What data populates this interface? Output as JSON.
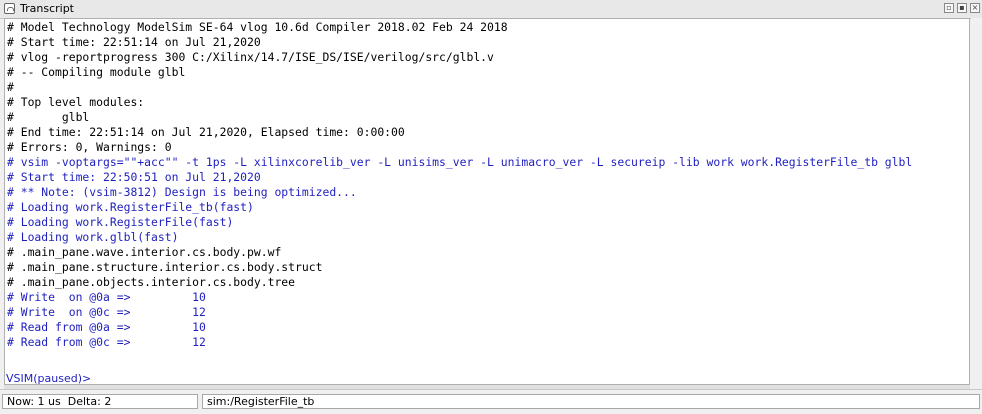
{
  "window": {
    "title": "Transcript"
  },
  "transcript": {
    "lines": [
      {
        "text": "# Model Technology ModelSim SE-64 vlog 10.6d Compiler 2018.02 Feb 24 2018",
        "blue": false
      },
      {
        "text": "# Start time: 22:51:14 on Jul 21,2020",
        "blue": false
      },
      {
        "text": "# vlog -reportprogress 300 C:/Xilinx/14.7/ISE_DS/ISE/verilog/src/glbl.v",
        "blue": false
      },
      {
        "text": "# -- Compiling module glbl",
        "blue": false
      },
      {
        "text": "#",
        "blue": false
      },
      {
        "text": "# Top level modules:",
        "blue": false
      },
      {
        "text": "#       glbl",
        "blue": false
      },
      {
        "text": "# End time: 22:51:14 on Jul 21,2020, Elapsed time: 0:00:00",
        "blue": false
      },
      {
        "text": "# Errors: 0, Warnings: 0",
        "blue": false
      },
      {
        "text": "# vsim -voptargs=\"\"+acc\"\" -t 1ps -L xilinxcorelib_ver -L unisims_ver -L unimacro_ver -L secureip -lib work work.RegisterFile_tb glbl",
        "blue": true
      },
      {
        "text": "# Start time: 22:50:51 on Jul 21,2020",
        "blue": true
      },
      {
        "text": "# ** Note: (vsim-3812) Design is being optimized...",
        "blue": true
      },
      {
        "text": "# Loading work.RegisterFile_tb(fast)",
        "blue": true
      },
      {
        "text": "# Loading work.RegisterFile(fast)",
        "blue": true
      },
      {
        "text": "# Loading work.glbl(fast)",
        "blue": true
      },
      {
        "text": "# .main_pane.wave.interior.cs.body.pw.wf",
        "blue": false
      },
      {
        "text": "# .main_pane.structure.interior.cs.body.struct",
        "blue": false
      },
      {
        "text": "# .main_pane.objects.interior.cs.body.tree",
        "blue": false
      },
      {
        "text": "# Write  on @0a =>         10",
        "blue": true
      },
      {
        "text": "# Write  on @0c =>         12",
        "blue": true
      },
      {
        "text": "# Read from @0a =>         10",
        "blue": true
      },
      {
        "text": "# Read from @0c =>         12",
        "blue": true
      }
    ],
    "prompt": "VSIM(paused)>"
  },
  "status": {
    "now": "Now: 1 us",
    "delta": "Delta: 2",
    "context": "sim:/RegisterFile_tb"
  },
  "colors": {
    "blue": "#1f1fbf"
  }
}
